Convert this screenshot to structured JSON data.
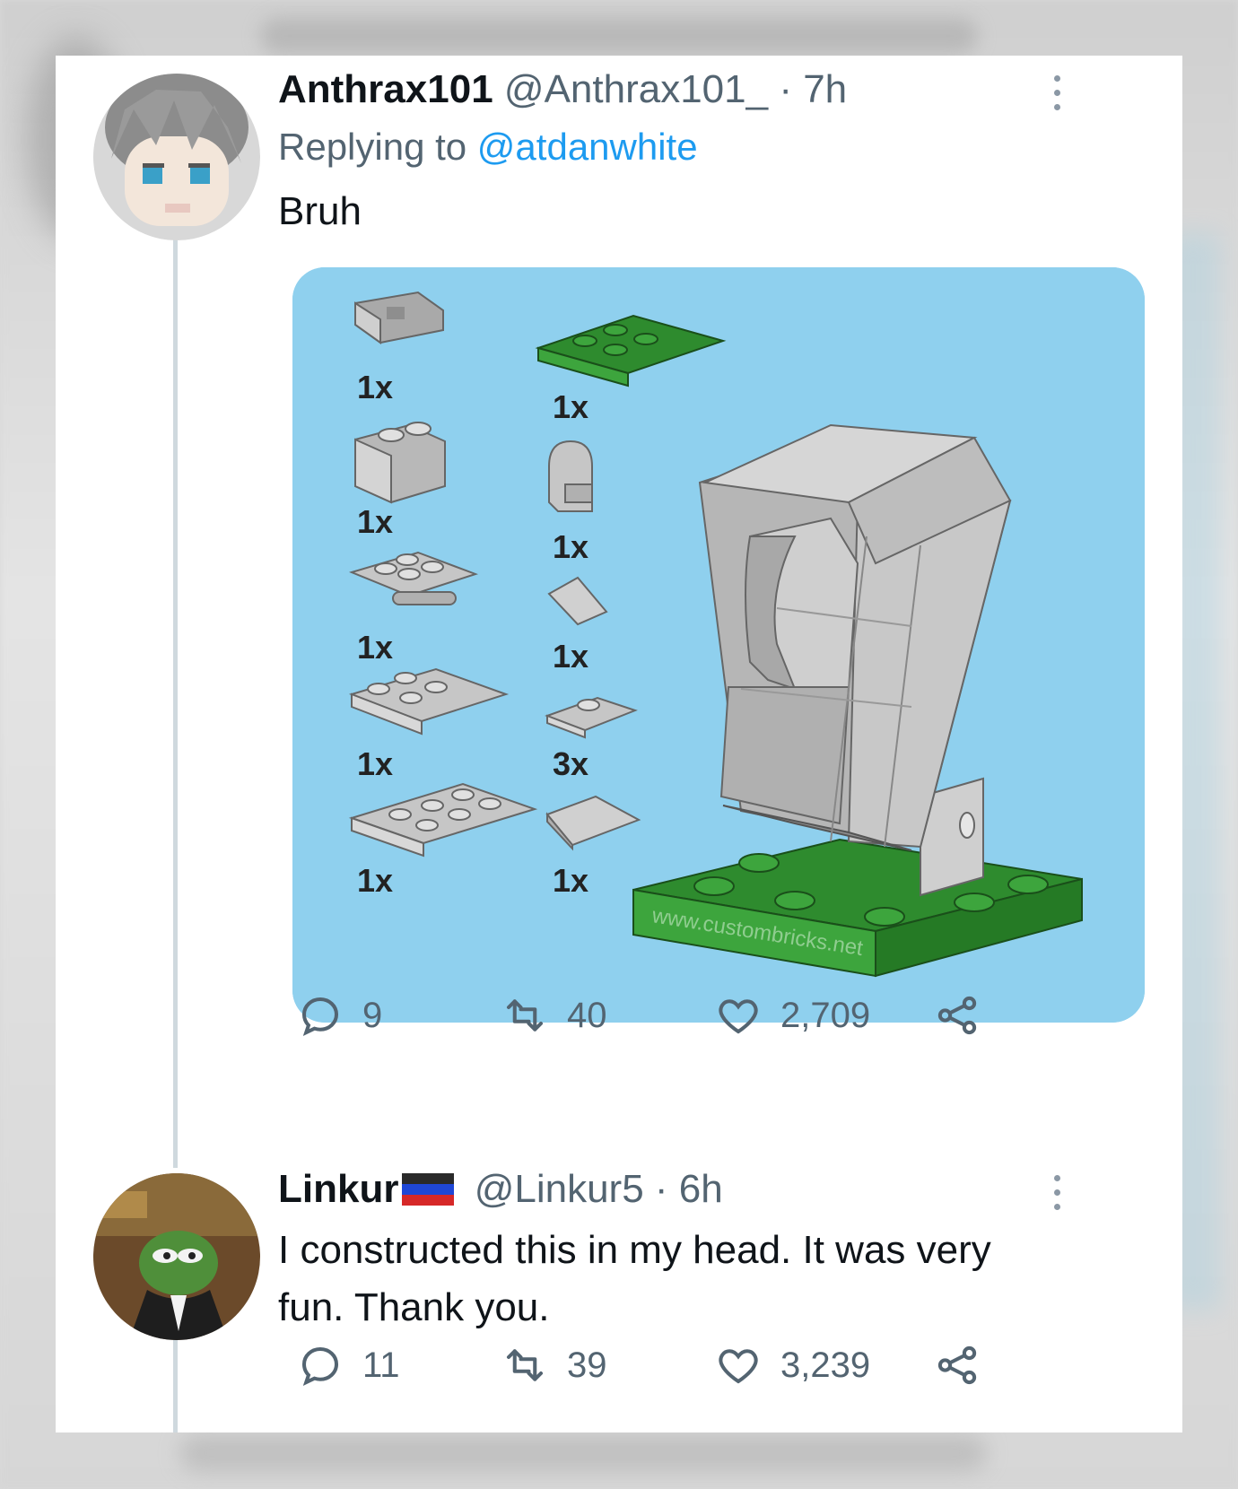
{
  "tweet1": {
    "name": "Anthrax101",
    "handle": "@Anthrax101_",
    "time": "· 7h",
    "replying_prefix": "Replying to",
    "replying_mention": "@atdanwhite",
    "text": "Bruh",
    "media": {
      "parts_left_counts": [
        "1x",
        "1x",
        "1x",
        "1x",
        "1x"
      ],
      "parts_right_counts": [
        "1x",
        "1x",
        "1x",
        "3x",
        "1x"
      ],
      "watermark": "www.custombricks.net",
      "colors": {
        "background": "#8fd0ee",
        "brick_gray": "#b8b8b8",
        "brick_green": "#2e8b2e"
      }
    },
    "replies": "9",
    "retweets": "40",
    "likes": "2,709"
  },
  "tweet2": {
    "name": "Linkur",
    "handle": "@Linkur5",
    "time": "· 6h",
    "text_line1": "I constructed this in my head. It was very",
    "text_line2": "fun. Thank you.",
    "replies": "11",
    "retweets": "39",
    "likes": "3,239"
  },
  "icons": [
    "more-icon",
    "reply-icon",
    "retweet-icon",
    "like-icon",
    "share-icon",
    "flag-icon"
  ],
  "colors": {
    "text": "#0f1419",
    "muted": "#536471",
    "link": "#1d9bf0",
    "thread_line": "#cfd9de"
  }
}
